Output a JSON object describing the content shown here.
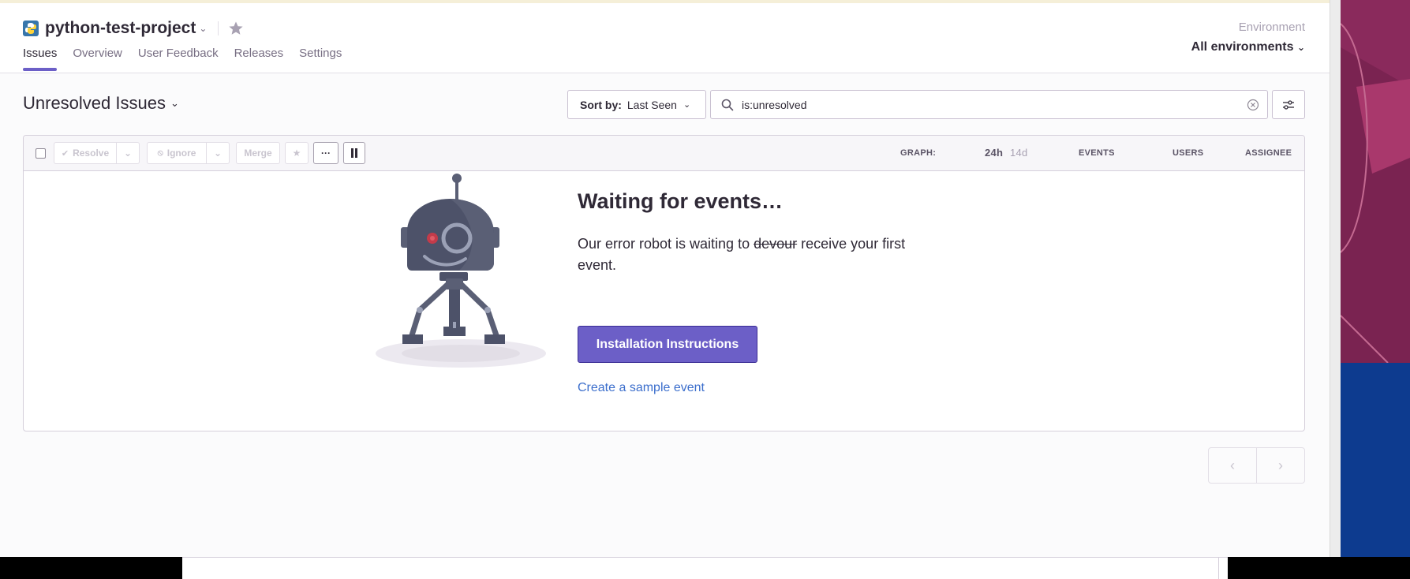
{
  "project": {
    "name": "python-test-project",
    "icon": "python-logo-icon"
  },
  "nav": {
    "tabs": [
      {
        "label": "Issues",
        "active": true
      },
      {
        "label": "Overview"
      },
      {
        "label": "User Feedback"
      },
      {
        "label": "Releases"
      },
      {
        "label": "Settings"
      }
    ]
  },
  "environment": {
    "label": "Environment",
    "value": "All environments"
  },
  "issues": {
    "title": "Unresolved Issues",
    "sort_label": "Sort by:",
    "sort_value": "Last Seen",
    "search_value": "is:unresolved"
  },
  "toolbar": {
    "resolve": "Resolve",
    "ignore": "Ignore",
    "merge": "Merge",
    "graph": "GRAPH:",
    "graph_24h": "24h",
    "graph_14d": "14d",
    "events": "EVENTS",
    "users": "USERS",
    "assignee": "ASSIGNEE"
  },
  "empty_state": {
    "title": "Waiting for events…",
    "desc_before": "Our error robot is waiting to ",
    "desc_struck": "devour",
    "desc_after": " receive your first event.",
    "install_button": "Installation Instructions",
    "sample_link": "Create a sample event"
  },
  "colors": {
    "accent": "#6c5fc7",
    "link": "#3b6ecc",
    "text": "#2f2936"
  }
}
